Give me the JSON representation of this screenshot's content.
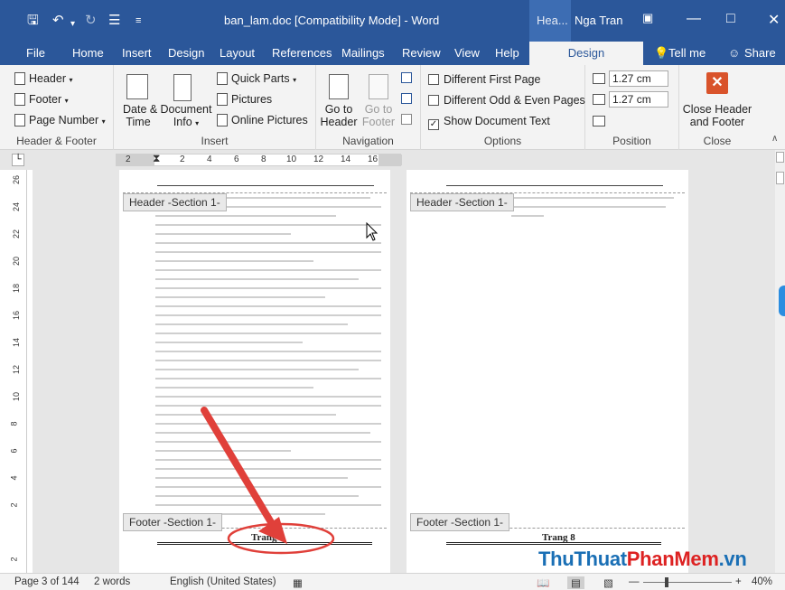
{
  "titlebar": {
    "doc_title": "ban_lam.doc [Compatibility Mode]  -  Word",
    "contextual_tab": "Hea...",
    "user": "Nga Tran"
  },
  "tabs": [
    "File",
    "Home",
    "Insert",
    "Design",
    "Layout",
    "References",
    "Mailings",
    "Review",
    "View",
    "Help"
  ],
  "active_tab": "Design",
  "tell_me": "Tell me",
  "share": "Share",
  "ribbon": {
    "header_footer": {
      "header": "Header",
      "footer": "Footer",
      "page_number": "Page Number",
      "label": "Header & Footer"
    },
    "insert": {
      "date_time": "Date &",
      "date_time_2": "Time",
      "document_info": "Document",
      "document_info_2": "Info",
      "quick_parts": "Quick Parts",
      "pictures": "Pictures",
      "online_pictures": "Online Pictures",
      "label": "Insert"
    },
    "navigation": {
      "go_to_header": "Go to",
      "go_to_header_2": "Header",
      "go_to_footer": "Go to",
      "go_to_footer_2": "Footer",
      "label": "Navigation"
    },
    "options": {
      "different_first": "Different First Page",
      "different_odd_even": "Different Odd & Even Pages",
      "show_document_text": "Show Document Text",
      "label": "Options"
    },
    "position": {
      "header_from_top": "1.27 cm",
      "footer_from_bottom": "1.27 cm",
      "label": "Position"
    },
    "close": {
      "close_label": "Close Header",
      "close_label_2": "and Footer",
      "label": "Close"
    }
  },
  "ruler_numbers": [
    "2",
    "2",
    "4",
    "6",
    "8",
    "10",
    "12",
    "14",
    "16"
  ],
  "vruler_numbers": [
    "26",
    "24",
    "22",
    "20",
    "18",
    "16",
    "14",
    "12",
    "10",
    "8",
    "6",
    "4",
    "2",
    "2"
  ],
  "pages": {
    "left_header_tag": "Header -Section 1-",
    "left_footer_tag": "Footer -Section 1-",
    "left_page_label": "Trang 7",
    "right_header_tag": "Header -Section 1-",
    "right_footer_tag": "Footer -Section 1-",
    "right_page_label": "Trang 8"
  },
  "statusbar": {
    "page": "Page 3 of 144",
    "words": "2 words",
    "language": "English (United States)",
    "zoom": "40%"
  },
  "watermark": {
    "part1": "ThuThuat",
    "part2": "PhanMem",
    "part3": ".vn"
  },
  "colors": {
    "word_blue": "#2b579a",
    "annotation_red": "#e0403a"
  }
}
